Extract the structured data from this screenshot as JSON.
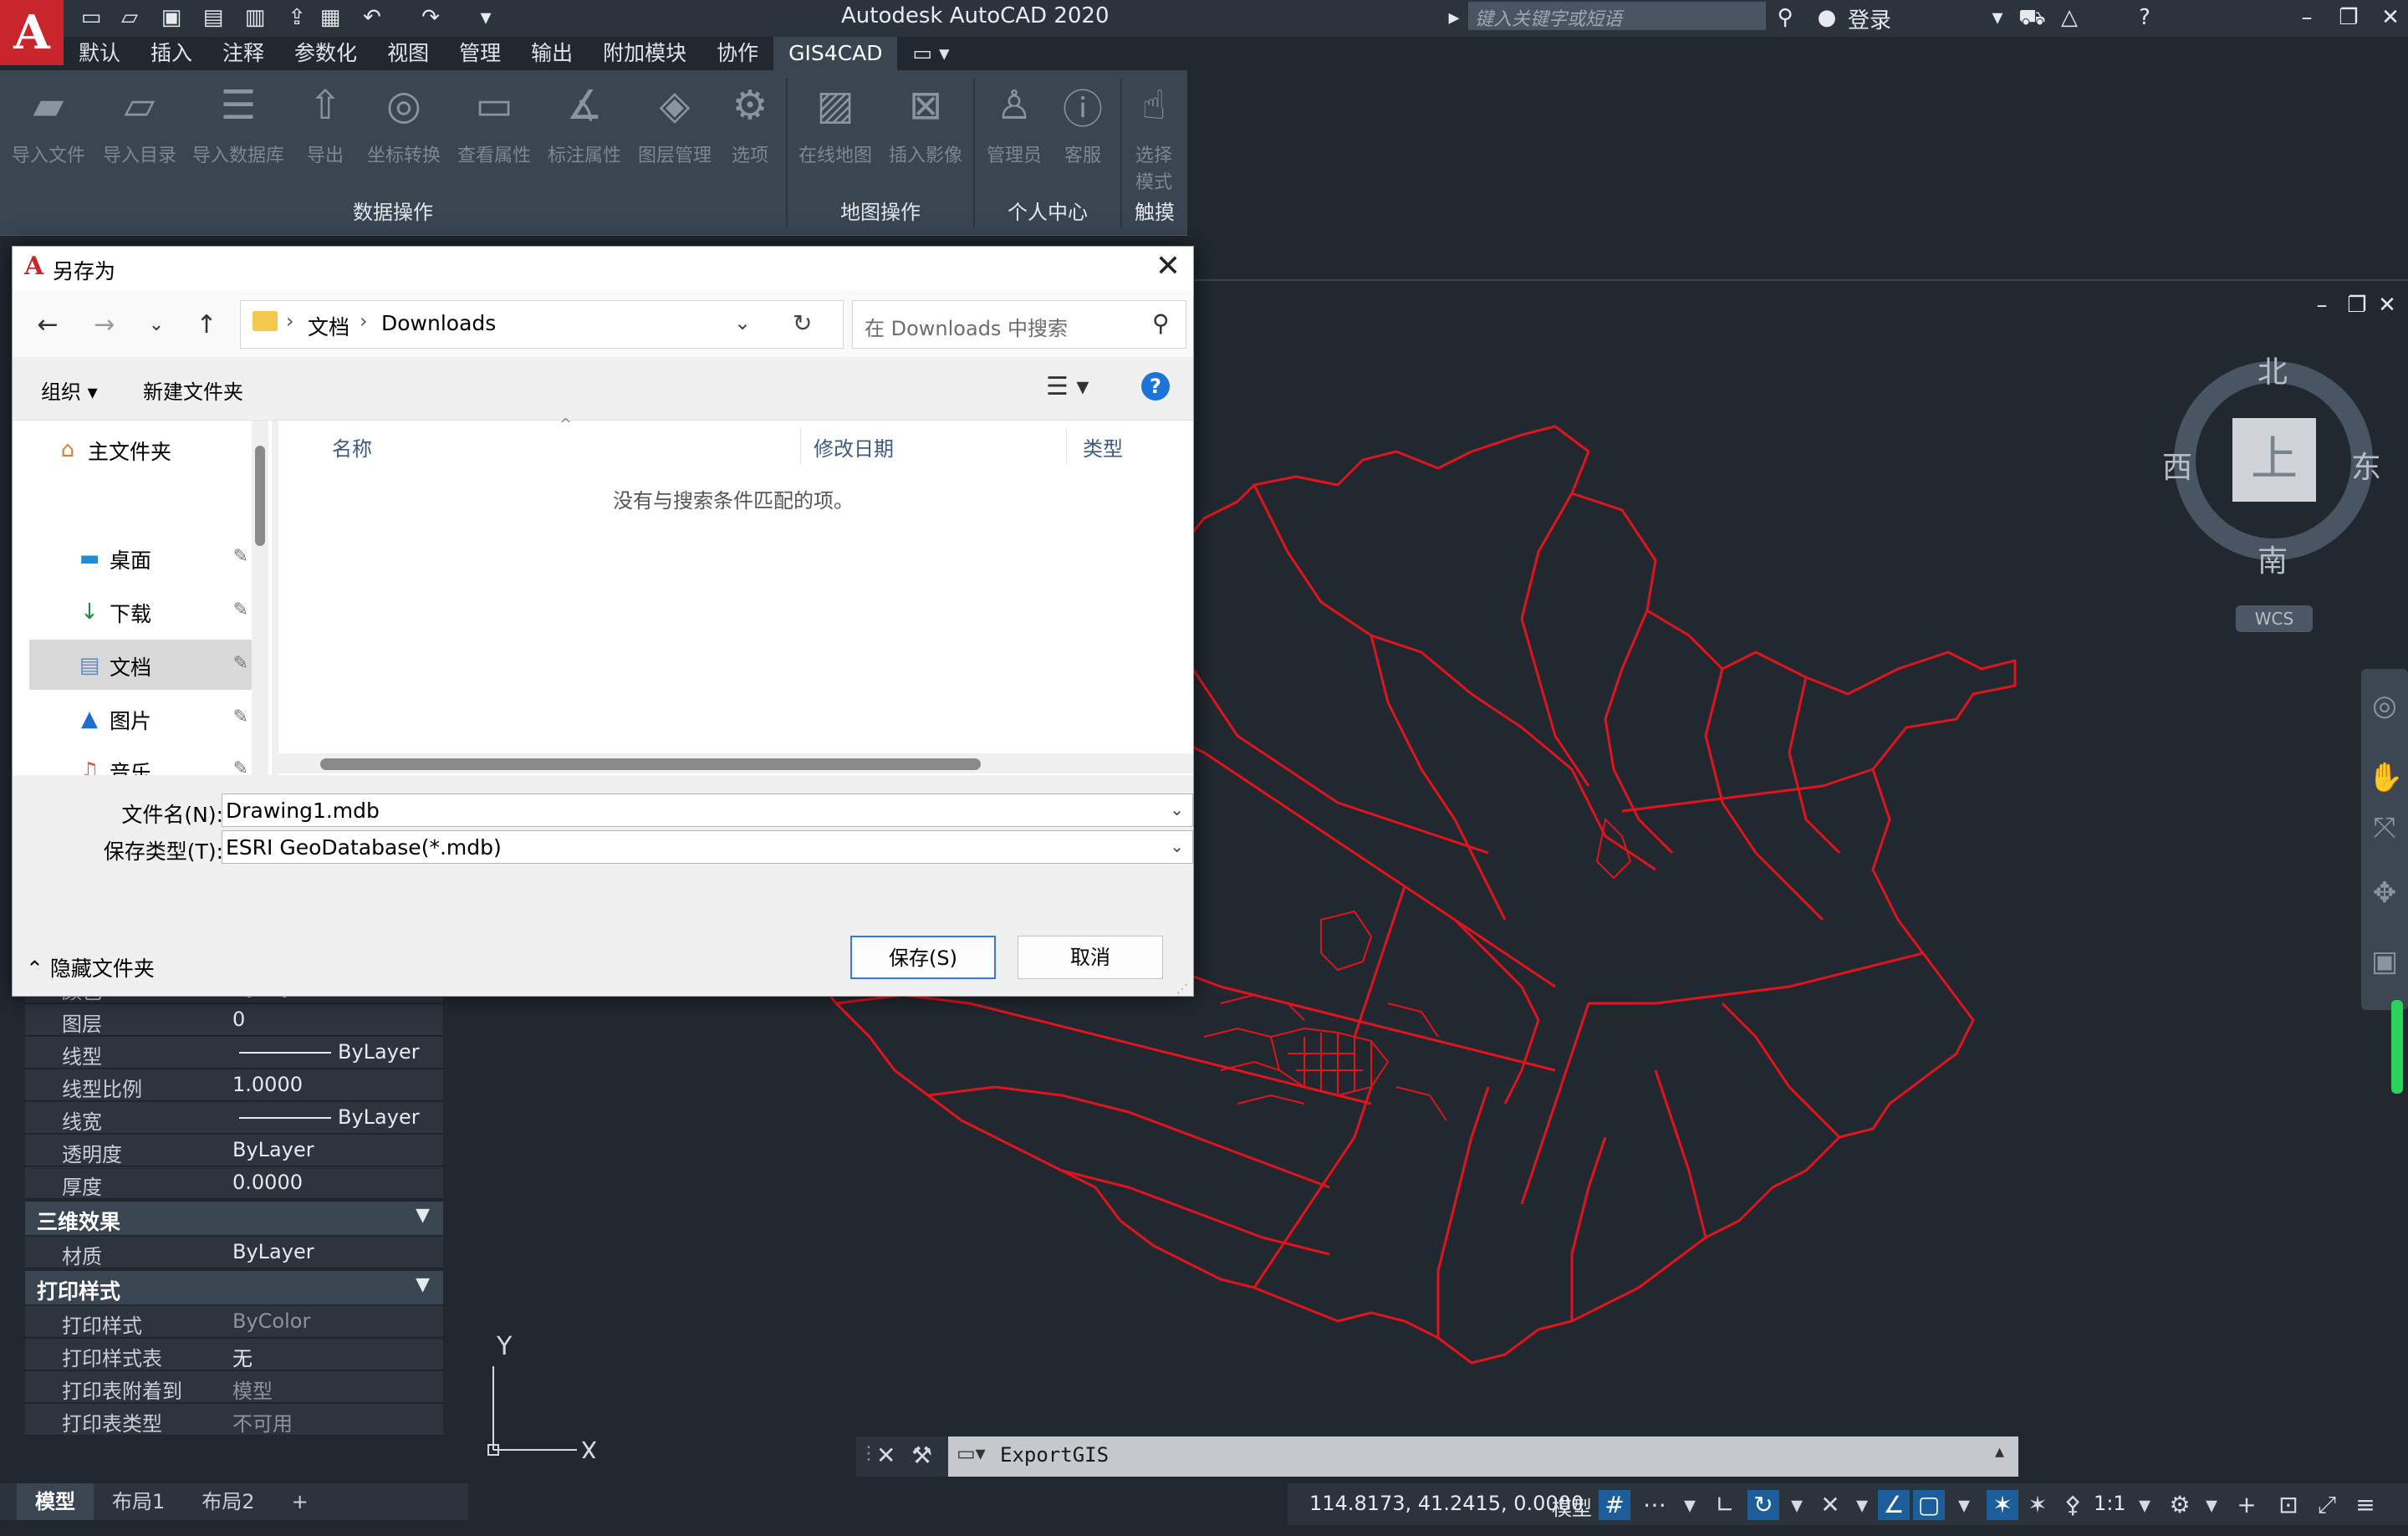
{
  "app": {
    "title": "Autodesk AutoCAD 2020",
    "logo": "A",
    "search_placeholder": "键入关键字或短语",
    "login": "登录"
  },
  "ribbon": {
    "tabs": [
      "默认",
      "插入",
      "注释",
      "参数化",
      "视图",
      "管理",
      "输出",
      "附加模块",
      "协作",
      "GIS4CAD"
    ],
    "active_tab": "GIS4CAD",
    "buttons": [
      {
        "label": "导入文件",
        "icon": "folder-import-icon"
      },
      {
        "label": "导入目录",
        "icon": "folder-open-icon"
      },
      {
        "label": "导入数据库",
        "icon": "database-icon"
      },
      {
        "label": "导出",
        "icon": "export-icon"
      },
      {
        "label": "坐标转换",
        "icon": "coordinate-transform-icon"
      },
      {
        "label": "查看属性",
        "icon": "view-attributes-icon"
      },
      {
        "label": "标注属性",
        "icon": "label-attributes-icon"
      },
      {
        "label": "图层管理",
        "icon": "layers-icon"
      },
      {
        "label": "选项",
        "icon": "gear-icon"
      },
      {
        "label": "在线地图",
        "icon": "online-map-icon"
      },
      {
        "label": "插入影像",
        "icon": "insert-image-icon"
      },
      {
        "label": "管理员",
        "icon": "user-icon"
      },
      {
        "label": "客服",
        "icon": "info-icon"
      },
      {
        "label": "选择",
        "label2": "模式",
        "icon": "hand-pointer-icon"
      }
    ],
    "groups": [
      "数据操作",
      "地图操作",
      "个人中心",
      "触摸"
    ]
  },
  "dialog": {
    "title": "另存为",
    "breadcrumb": [
      "文档",
      "Downloads"
    ],
    "search_placeholder": "在 Downloads 中搜索",
    "organize": "组织",
    "new_folder": "新建文件夹",
    "tree": [
      {
        "label": "主文件夹",
        "icon": "home-icon"
      },
      {
        "label": "桌面",
        "icon": "desktop-icon"
      },
      {
        "label": "下载",
        "icon": "download-icon"
      },
      {
        "label": "文档",
        "icon": "documents-icon"
      },
      {
        "label": "图片",
        "icon": "pictures-icon"
      },
      {
        "label": "音乐",
        "icon": "music-icon"
      }
    ],
    "selected_tree_item": "文档",
    "columns": [
      "名称",
      "修改日期",
      "类型"
    ],
    "empty_message": "没有与搜索条件匹配的项。",
    "filename_label": "文件名(N):",
    "filename_value": "Drawing1.mdb",
    "filetype_label": "保存类型(T):",
    "filetype_value": "ESRI GeoDatabase(*.mdb)",
    "hide_folders": "隐藏文件夹",
    "save_button": "保存(S)",
    "cancel_button": "取消"
  },
  "properties": {
    "rows": [
      {
        "key": "颜色",
        "value": "ByLayer"
      },
      {
        "key": "图层",
        "value": "0"
      },
      {
        "key": "线型",
        "value": "ByLayer"
      },
      {
        "key": "线型比例",
        "value": "1.0000"
      },
      {
        "key": "线宽",
        "value": "ByLayer"
      },
      {
        "key": "透明度",
        "value": "ByLayer"
      },
      {
        "key": "厚度",
        "value": "0.0000"
      }
    ],
    "section_3d": "三维效果",
    "rows_3d": [
      {
        "key": "材质",
        "value": "ByLayer"
      }
    ],
    "section_plot": "打印样式",
    "rows_plot": [
      {
        "key": "打印样式",
        "value": "ByColor"
      },
      {
        "key": "打印样式表",
        "value": "无"
      },
      {
        "key": "打印表附着到",
        "value": "模型"
      },
      {
        "key": "打印表类型",
        "value": "不可用"
      }
    ]
  },
  "viewcube": {
    "north": "北",
    "south": "南",
    "east": "东",
    "west": "西",
    "top": "上",
    "wcs": "WCS"
  },
  "ucs": {
    "x": "X",
    "y": "Y"
  },
  "command_line": "ExportGIS",
  "layout_tabs": [
    "模型",
    "布局1",
    "布局2",
    "+"
  ],
  "status": {
    "coords": "114.8173, 41.2415, 0.0000",
    "model": "模型",
    "scale": "1:1"
  },
  "colors": {
    "map_stroke": "#e0141c",
    "accent": "#1c5d9a",
    "ribbon_bg": "#3a4552",
    "canvas_bg": "#212830"
  }
}
